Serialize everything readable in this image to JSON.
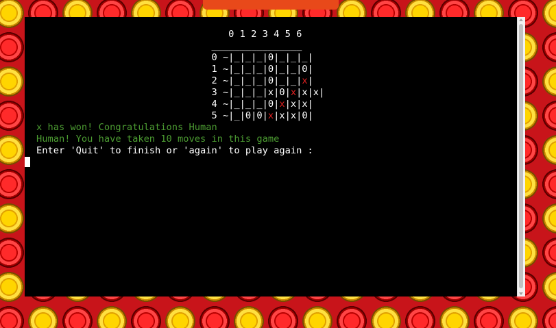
{
  "terminal": {
    "column_header": "                                  0 1 2 3 4 5 6",
    "separator": "                               ________________",
    "board_rows": [
      [
        "                               0 ~|_|_|_|0|_|_|_|"
      ],
      [
        "                               1 ~|_|_|_|0|_|_|0|"
      ],
      [
        "                               2 ~|_|_|_|0|_|_|",
        {
          "red": "x"
        },
        "|"
      ],
      [
        "                               3 ~|_|_|_|x|0|",
        {
          "red": "x"
        },
        "|x|x|"
      ],
      [
        "                               4 ~|_|_|_|0|",
        {
          "red": "x"
        },
        "|x|x|"
      ],
      [
        "                               5 ~|_|0|0|",
        {
          "red": "x"
        },
        "|x|x|0|"
      ]
    ],
    "win_message": "x has won! Congratulations Human",
    "moves_message": "Human! You have taken 10 moves in this game",
    "prompt": "Enter 'Quit' to finish or 'again' to play again :"
  },
  "colors": {
    "terminal_bg": "#000000",
    "text": "#ffffff",
    "success_text": "#4c9c32",
    "highlight_piece": "#e02020",
    "run_button": "#e8491a"
  }
}
